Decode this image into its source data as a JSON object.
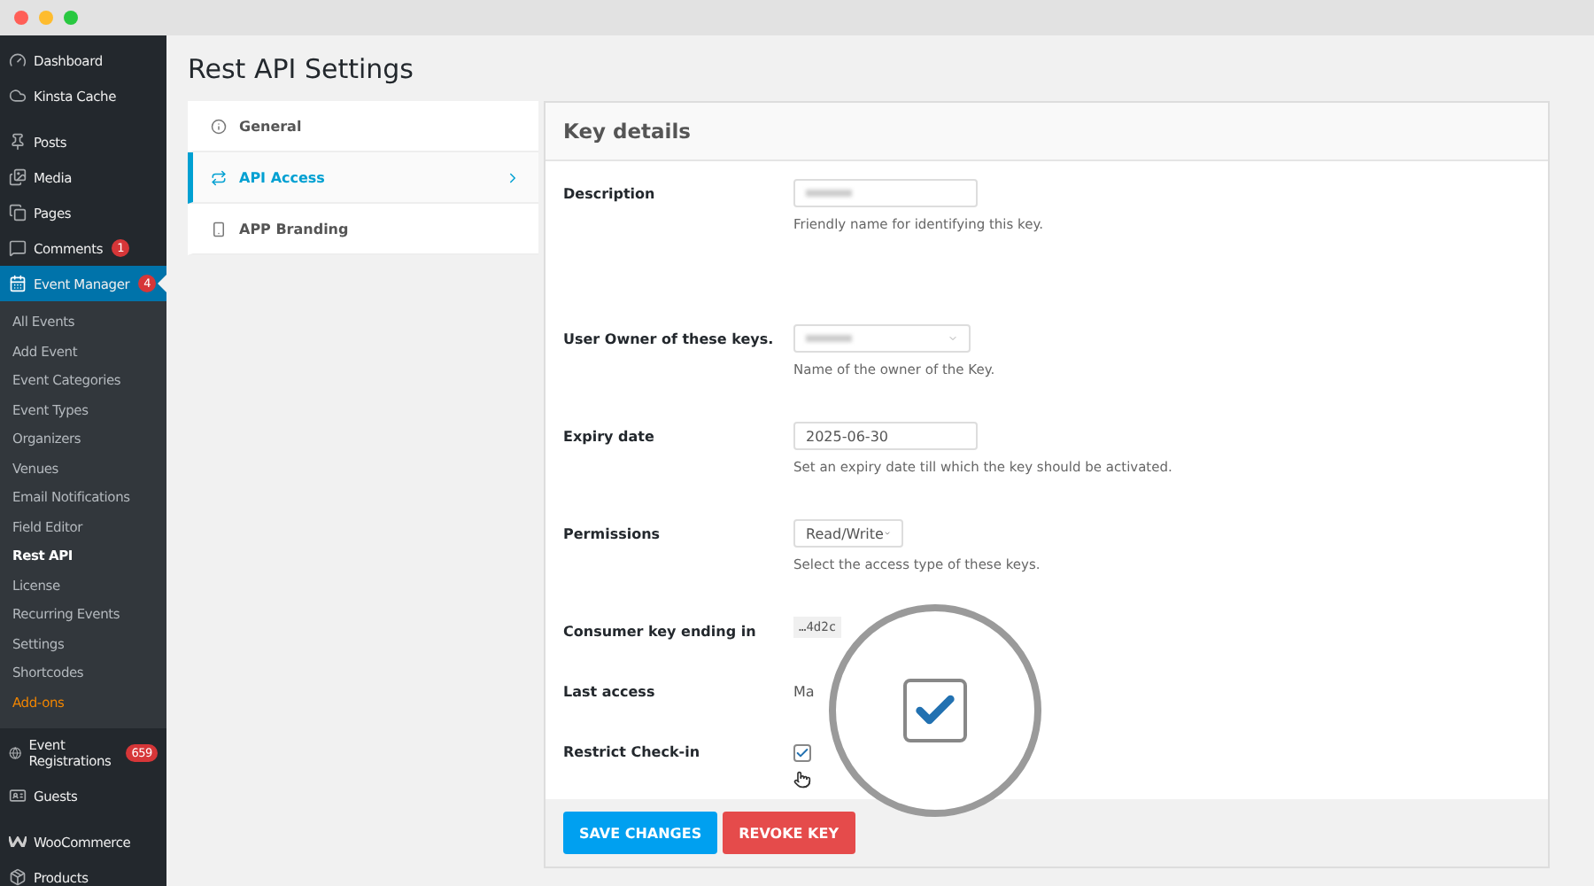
{
  "sidebar": {
    "items": [
      {
        "label": "Dashboard",
        "selected": false
      },
      {
        "label": "Kinsta Cache",
        "selected": false
      },
      {
        "label": "Posts",
        "selected": false
      },
      {
        "label": "Media",
        "selected": false
      },
      {
        "label": "Pages",
        "selected": false
      },
      {
        "label": "Comments",
        "badge": "1",
        "selected": false
      },
      {
        "label": "Event Manager",
        "badge": "4",
        "selected": true,
        "children": [
          {
            "label": "All Events",
            "selected": false
          },
          {
            "label": "Add Event",
            "selected": false
          },
          {
            "label": "Event Categories",
            "selected": false
          },
          {
            "label": "Event Types",
            "selected": false
          },
          {
            "label": "Organizers",
            "selected": false
          },
          {
            "label": "Venues",
            "selected": false
          },
          {
            "label": "Email Notifications",
            "selected": false
          },
          {
            "label": "Field Editor",
            "selected": false
          },
          {
            "label": "Rest API",
            "selected": true
          },
          {
            "label": "License",
            "selected": false
          },
          {
            "label": "Recurring Events",
            "selected": false
          },
          {
            "label": "Settings",
            "selected": false
          },
          {
            "label": "Shortcodes",
            "selected": false
          },
          {
            "label": "Add-ons",
            "selected": false,
            "kind": "highlight"
          }
        ]
      },
      {
        "label": "Event Registrations",
        "badge": "659",
        "selected": false
      },
      {
        "label": "Guests",
        "selected": false
      },
      {
        "label": "WooCommerce",
        "selected": false
      },
      {
        "label": "Products",
        "selected": false
      }
    ]
  },
  "page_title": "Rest API Settings",
  "tabs": [
    {
      "label": "General",
      "selected": false
    },
    {
      "label": "API Access",
      "selected": true
    },
    {
      "label": "APP Branding",
      "selected": false
    }
  ],
  "panel": {
    "title": "Key details",
    "fields": [
      {
        "label": "Description",
        "kind": "text",
        "help": "Friendly name for identifying this key."
      },
      {
        "label": "User Owner of these keys.",
        "kind": "select",
        "help": "Name of the owner of the Key."
      },
      {
        "label": "Expiry date",
        "kind": "text",
        "value": "2025-06-30",
        "help": "Set an expiry date till which the key should be activated."
      },
      {
        "label": "Permissions",
        "kind": "dropdown",
        "value": "Read/Write",
        "help": "Select the access type of these keys."
      },
      {
        "label": "Consumer key ending in",
        "kind": "code",
        "value": "…4d2c"
      },
      {
        "label": "Last access",
        "kind": "plain",
        "value": "Ma"
      },
      {
        "label": "Restrict Check-in",
        "kind": "checkbox",
        "checked": true
      }
    ]
  },
  "buttons": [
    {
      "label": "SAVE CHANGES",
      "kind": "primary"
    },
    {
      "label": "REVOKE KEY",
      "kind": "danger"
    }
  ]
}
